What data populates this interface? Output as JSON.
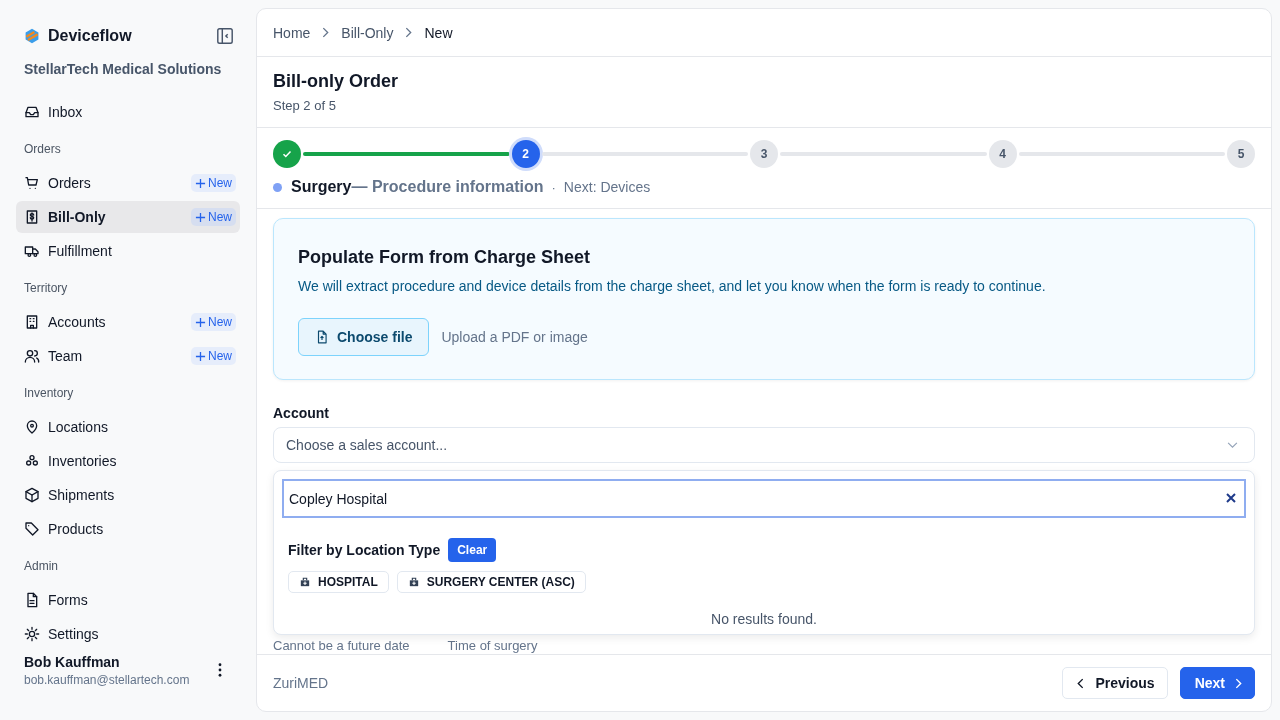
{
  "app": {
    "name": "Deviceflow",
    "org": "StellarTech Medical Solutions"
  },
  "nav": [
    {
      "kind": "item",
      "label": "Inbox",
      "selected": false
    },
    {
      "kind": "heading",
      "label": "Orders"
    },
    {
      "kind": "item",
      "label": "Orders",
      "selected": false,
      "badge": "New"
    },
    {
      "kind": "item",
      "label": "Bill-Only",
      "selected": true,
      "badge": "New"
    },
    {
      "kind": "item",
      "label": "Fulfillment",
      "selected": false
    },
    {
      "kind": "heading",
      "label": "Territory"
    },
    {
      "kind": "item",
      "label": "Accounts",
      "selected": false,
      "badge": "New"
    },
    {
      "kind": "item",
      "label": "Team",
      "selected": false,
      "badge": "New"
    },
    {
      "kind": "heading",
      "label": "Inventory"
    },
    {
      "kind": "item",
      "label": "Locations",
      "selected": false
    },
    {
      "kind": "item",
      "label": "Inventories",
      "selected": false
    },
    {
      "kind": "item",
      "label": "Shipments",
      "selected": false
    },
    {
      "kind": "item",
      "label": "Products",
      "selected": false
    },
    {
      "kind": "heading",
      "label": "Admin"
    },
    {
      "kind": "item",
      "label": "Forms",
      "selected": false
    },
    {
      "kind": "item",
      "label": "Settings",
      "selected": false
    }
  ],
  "user": {
    "name": "Bob Kauffman",
    "email": "bob.kauffman@stellartech.com"
  },
  "breadcrumbs": [
    {
      "label": "Home",
      "current": false
    },
    {
      "label": "Bill-Only",
      "current": false
    },
    {
      "label": "New",
      "current": true
    }
  ],
  "page": {
    "title": "Bill-only Order",
    "subtitle": "Step 2 of 5"
  },
  "steps": [
    {
      "completed": true,
      "selected": false
    },
    {
      "number": "2",
      "completed": false,
      "selected": true
    },
    {
      "number": "3",
      "completed": false,
      "selected": false
    },
    {
      "number": "4",
      "completed": false,
      "selected": false
    },
    {
      "number": "5",
      "completed": false,
      "selected": false
    }
  ],
  "step_caption": {
    "title": "Surgery",
    "subtitle": "— Procedure information",
    "separator": "·",
    "next": "Next: Devices"
  },
  "upload": {
    "title": "Populate Form from Charge Sheet",
    "description": "We will extract procedure and device details from the charge sheet, and let you know when the form is ready to continue.",
    "button": "Choose file",
    "hint": "Upload a PDF or image"
  },
  "account": {
    "label": "Account",
    "placeholder": "Choose a sales account...",
    "search_value": "Copley Hospital",
    "filter_label": "Filter by Location Type",
    "clear": "Clear",
    "chips": [
      {
        "label": "HOSPITAL",
        "selected": false
      },
      {
        "label": "SURGERY CENTER (ASC)",
        "selected": false
      }
    ],
    "empty": "No results found."
  },
  "field_hints": [
    "Cannot be a future date",
    "Time of surgery"
  ],
  "footer": {
    "vendor": "ZuriMED",
    "previous": "Previous",
    "next": "Next"
  }
}
